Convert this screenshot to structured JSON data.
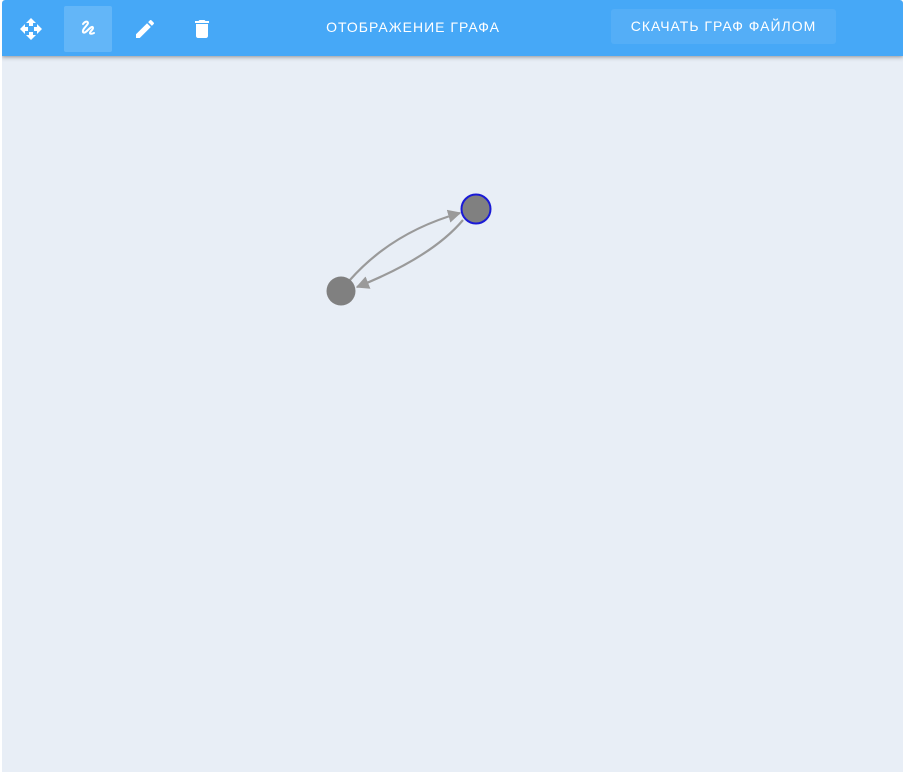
{
  "toolbar": {
    "title": "ОТОБРАЖЕНИЕ ГРАФА",
    "download_label": "СКАЧАТЬ ГРАФ ФАЙЛОМ",
    "tools": [
      {
        "name": "move-tool",
        "icon": "move-arrows-icon",
        "active": false
      },
      {
        "name": "draw-edge-tool",
        "icon": "gesture-icon",
        "active": true
      },
      {
        "name": "edit-tool",
        "icon": "pencil-icon",
        "active": false
      },
      {
        "name": "delete-tool",
        "icon": "trash-icon",
        "active": false
      }
    ]
  },
  "graph": {
    "nodes": [
      {
        "id": "node-1",
        "fill": "#808080",
        "selected": false
      },
      {
        "id": "node-2",
        "fill": "#808080",
        "selected": true,
        "stroke": "#1a1ad6"
      }
    ],
    "edges": [
      {
        "from": "node-1",
        "to": "node-2",
        "color": "#9a9a9a"
      },
      {
        "from": "node-2",
        "to": "node-1",
        "color": "#9a9a9a"
      }
    ]
  },
  "colors": {
    "toolbar_bg": "#46a8f7",
    "canvas_bg": "#e8eef6",
    "edge": "#9a9a9a",
    "node": "#808080",
    "selected_stroke": "#1a1ad6"
  }
}
